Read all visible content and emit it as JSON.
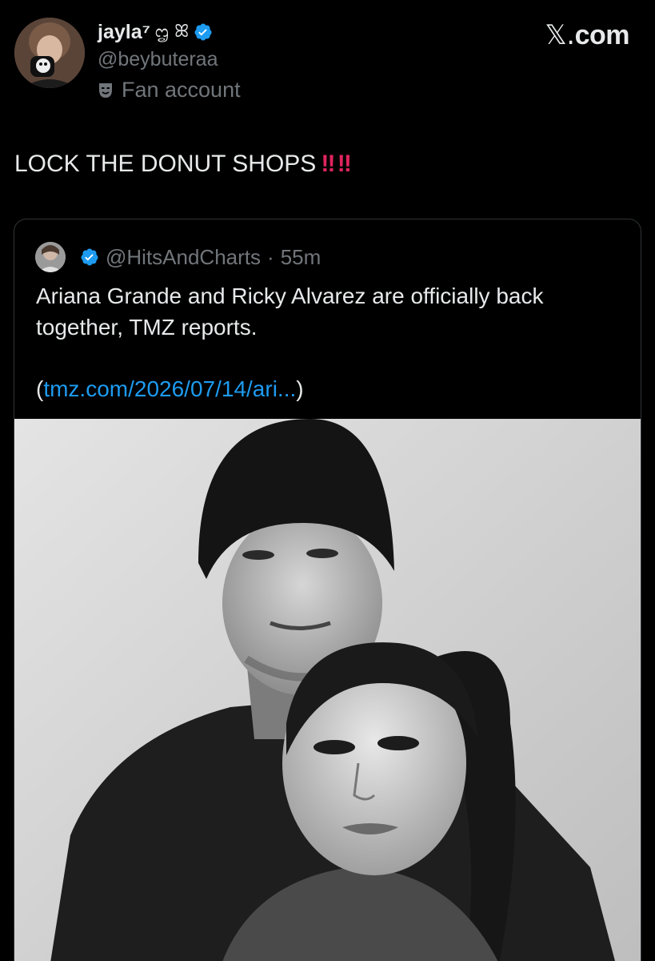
{
  "author": {
    "display_name": "jayla⁷",
    "name_emoji": "ᦗ ꕤ",
    "handle": "@beybuteraa",
    "affiliation": "Fan account"
  },
  "source": {
    "label": "com",
    "mark": "𝕏."
  },
  "tweet": {
    "text": "LOCK THE DONUT SHOPS",
    "emphasis": "‼ ‼"
  },
  "quote": {
    "handle": "@HitsAndCharts",
    "separator": "·",
    "time": "55m",
    "text": "Ariana Grande and Ricky Alvarez are officially back together, TMZ reports.",
    "link_open": "(",
    "link_text": "tmz.com/2026/07/14/ari...",
    "link_close": ")"
  },
  "colors": {
    "background": "#000000",
    "text": "#e7e9ea",
    "secondary": "#71767b",
    "link": "#1d9bf0",
    "verified": "#1d9bf0",
    "emphasis": "#e0245e"
  }
}
